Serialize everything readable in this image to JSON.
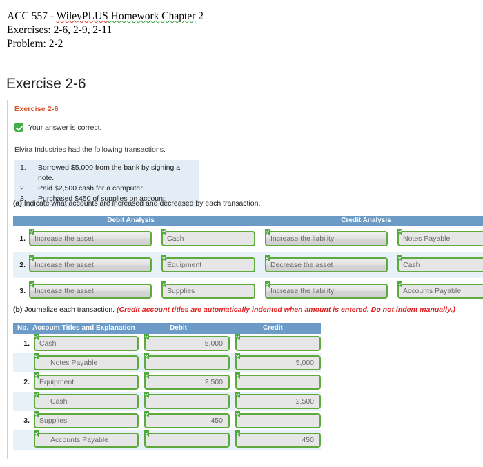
{
  "document_heading": {
    "line1_part1": "ACC 557 - ",
    "line1_part2": "WileyPLUS",
    "line1_part3": " Homework  Chapter",
    "line1_part4": " 2",
    "line2": "Exercises: 2-6, 2-9, 2-11",
    "line3": "Problem: 2-2"
  },
  "section": {
    "title": "Exercise 2-6"
  },
  "exercise": {
    "label": "Exercise 2-6",
    "status_text": "Your answer is correct.",
    "status_icon": "check-icon",
    "intro": "Elvira Industries had the following transactions.",
    "transactions": [
      {
        "num": "1.",
        "text": "Borrowed $5,000 from the bank by signing a note."
      },
      {
        "num": "2.",
        "text": "Paid $2,500 cash for a computer."
      },
      {
        "num": "3.",
        "text": "Purchased $450 of supplies on account."
      }
    ]
  },
  "part_a": {
    "prompt_prefix": "(a)",
    "prompt_text": " Indicate what accounts are increased and decreased by each transaction.",
    "header_debit": "Debit Analysis",
    "header_credit": "Credit Analysis",
    "rows": [
      {
        "num": "1.",
        "debit_effect": "Increase the asset",
        "debit_account": "Cash",
        "credit_effect": "Increase the liability",
        "credit_account": "Notes Payable"
      },
      {
        "num": "2.",
        "debit_effect": "Increase the asset",
        "debit_account": "Equipment",
        "credit_effect": "Decrease the asset",
        "credit_account": "Cash"
      },
      {
        "num": "3.",
        "debit_effect": "Increase the asset",
        "debit_account": "Supplies",
        "credit_effect": "Increase the liability",
        "credit_account": "Accounts Payable"
      }
    ]
  },
  "part_b": {
    "prompt_prefix": "(b)",
    "prompt_text": " Journalize each transaction. ",
    "prompt_note": "(Credit account titles are automatically indented when amount is entered. Do not indent manually.)",
    "header_no": "No.",
    "header_account": "Account Titles and Explanation",
    "header_debit": "Debit",
    "header_credit": "Credit",
    "rows": [
      {
        "num": "1.",
        "account": "Cash",
        "indent": false,
        "debit": "5,000",
        "credit": ""
      },
      {
        "num": "",
        "account": "Notes Payable",
        "indent": true,
        "debit": "",
        "credit": "5,000"
      },
      {
        "num": "2.",
        "account": "Equipment",
        "indent": false,
        "debit": "2,500",
        "credit": ""
      },
      {
        "num": "",
        "account": "Cash",
        "indent": true,
        "debit": "",
        "credit": "2,500"
      },
      {
        "num": "3.",
        "account": "Supplies",
        "indent": false,
        "debit": "450",
        "credit": ""
      },
      {
        "num": "",
        "account": "Accounts Payable",
        "indent": true,
        "debit": "",
        "credit": "450"
      }
    ]
  },
  "colors": {
    "header_blue": "#6c9bc8",
    "field_green": "#5faa3d",
    "exercise_orange": "#d9532c",
    "note_red": "#e02020",
    "row_tint": "#e9f1f8",
    "txn_bg": "#e4edf6"
  }
}
